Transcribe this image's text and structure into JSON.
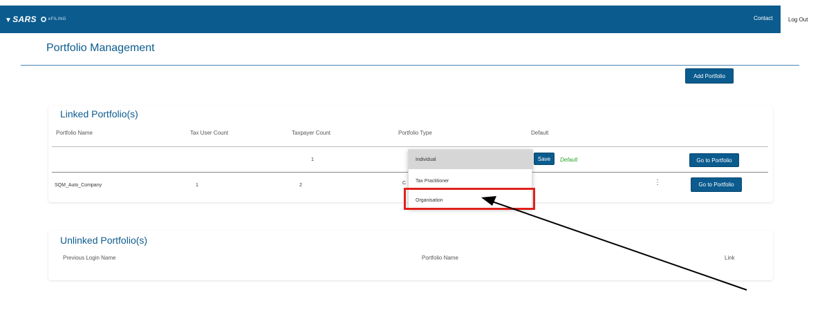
{
  "header": {
    "logo": "SARS",
    "efiling": "eFILING",
    "contact": "Contact",
    "logout": "Log Out",
    "color": "#0b5b8e"
  },
  "page": {
    "title": "Portfolio Management",
    "add_portfolio": "Add Portfolio"
  },
  "linked": {
    "heading": "Linked Portfolio(s)",
    "columns": [
      "Portfolio Name",
      "Tax User Count",
      "Taxpayer Count",
      "Portfolio Type",
      "Default"
    ],
    "row1": {
      "name": "",
      "tax_user_count": "",
      "taxpayer_count": "1",
      "save": "Save",
      "default": "Default",
      "goto": "Go to Portfolio"
    },
    "row2": {
      "name": "SQM_Auto_Company",
      "tax_user_count": "1",
      "taxpayer_count": "2",
      "portfolio_type_cut": "C",
      "kebab": "⋮",
      "goto": "Go to Portfolio"
    },
    "dropdown_options": [
      "Individual",
      "Tax Practitioner",
      "Organisation"
    ],
    "dropdown_selected": "Individual"
  },
  "unlinked": {
    "heading": "Unlinked Portfolio(s)",
    "columns": [
      "Previous Login Name",
      "Portfolio Name",
      "Link"
    ]
  },
  "colors": {
    "accent": "#0b5b8e",
    "highlight": "#e0211b",
    "default_text": "#2aa02a"
  }
}
